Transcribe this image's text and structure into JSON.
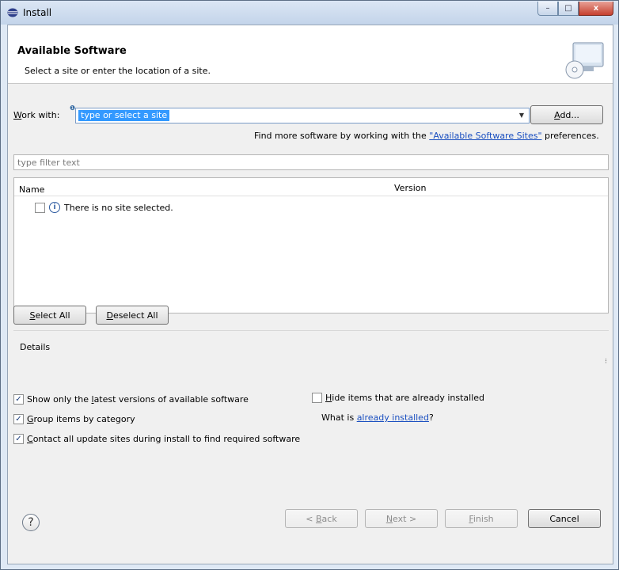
{
  "window": {
    "title": "Install",
    "minimize_glyph": "–",
    "maximize_glyph": "□",
    "close_glyph": "x"
  },
  "header": {
    "title": "Available Software",
    "subtitle": "Select a site or enter the location of a site."
  },
  "work_with": {
    "label_mnemonic": "W",
    "label_rest": "ork with:",
    "value": "type or select a site",
    "add_button_mnemonic": "A",
    "add_button_rest": "dd..."
  },
  "find_more": {
    "prefix": "Find more software by working with the ",
    "link": "\"Available Software Sites\"",
    "suffix": " preferences."
  },
  "filter": {
    "placeholder": "type filter text"
  },
  "table": {
    "columns": [
      "Name",
      "Version"
    ],
    "rows": [
      {
        "text": "There is no site selected.",
        "checked": false,
        "icon": "info-icon"
      }
    ]
  },
  "selection_buttons": {
    "select_all_mnemonic": "S",
    "select_all_rest": "elect All",
    "deselect_all_mnemonic": "D",
    "deselect_all_rest": "eselect All"
  },
  "details": {
    "label": "Details"
  },
  "options": {
    "show_latest": {
      "before": "Show only the ",
      "mnemonic": "l",
      "after": "atest versions of available software",
      "checked": true
    },
    "group_by_category": {
      "before": "",
      "mnemonic": "G",
      "after": "roup items by category",
      "checked": true
    },
    "contact_all_sites": {
      "before": "",
      "mnemonic": "C",
      "after": "ontact all update sites during install to find required software",
      "checked": true
    },
    "hide_installed": {
      "before": "",
      "mnemonic": "H",
      "after": "ide items that are already installed",
      "checked": false
    },
    "what_is_prefix": "What is ",
    "already_installed_link": "already installed",
    "what_is_suffix": "?"
  },
  "footer": {
    "help_glyph": "?",
    "back": {
      "before": "< ",
      "mnemonic": "B",
      "after": "ack"
    },
    "next": {
      "before": "",
      "mnemonic": "N",
      "after": "ext >"
    },
    "finish": {
      "before": "",
      "mnemonic": "F",
      "after": "inish"
    },
    "cancel": "Cancel"
  }
}
